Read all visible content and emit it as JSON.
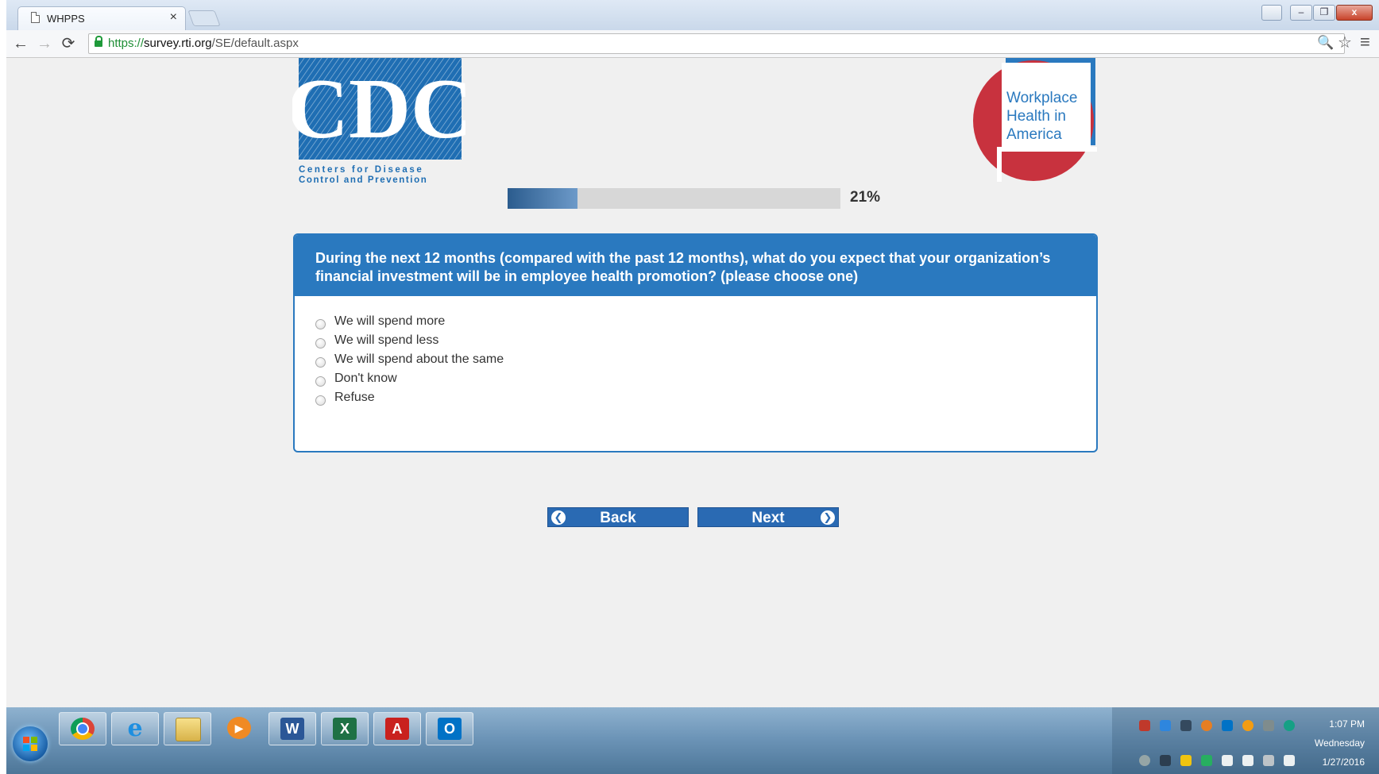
{
  "browser": {
    "tab_title": "WHPPS",
    "tab_close": "×",
    "url_scheme": "https://",
    "url_host": "survey.rti.org",
    "url_path": "/SE/default.aspx",
    "back_symbol": "←",
    "forward_symbol": "→",
    "reload_symbol": "⟳",
    "zoom_symbol": "🔍",
    "star_symbol": "☆",
    "menu_symbol": "≡",
    "window_minimize": "–",
    "window_restore": "❐",
    "window_close": "x"
  },
  "header": {
    "cdc_letters": "CDC",
    "cdc_tagline_line1": "Centers for Disease",
    "cdc_tagline_line2": "Control and Prevention",
    "wha_line1": "Workplace",
    "wha_line2": "Health in",
    "wha_line3": "America"
  },
  "progress": {
    "percent": 21,
    "label": "21%"
  },
  "question": {
    "text": "During the next 12 months (compared with the past 12 months), what do you expect that your organization’s financial investment will be in employee health promotion? (please choose one)",
    "options": [
      "We will spend more",
      "We will spend less",
      "We will spend about the same",
      "Don't know",
      "Refuse"
    ]
  },
  "navigation": {
    "back_label": "Back",
    "next_label": "Next"
  },
  "taskbar": {
    "clock_time": "1:07 PM",
    "clock_day": "Wednesday",
    "clock_date": "1/27/2016",
    "apps": [
      "chrome-icon",
      "internet-explorer-icon",
      "file-explorer-icon",
      "media-player-icon",
      "word-icon",
      "excel-icon",
      "acrobat-icon",
      "outlook-icon"
    ]
  },
  "colors": {
    "accent_blue": "#2a79bf",
    "button_blue": "#2a6ab3",
    "cdc_blue": "#1f6eb3",
    "wha_red": "#c8323e",
    "progress_fill": "#2b5c8e"
  }
}
